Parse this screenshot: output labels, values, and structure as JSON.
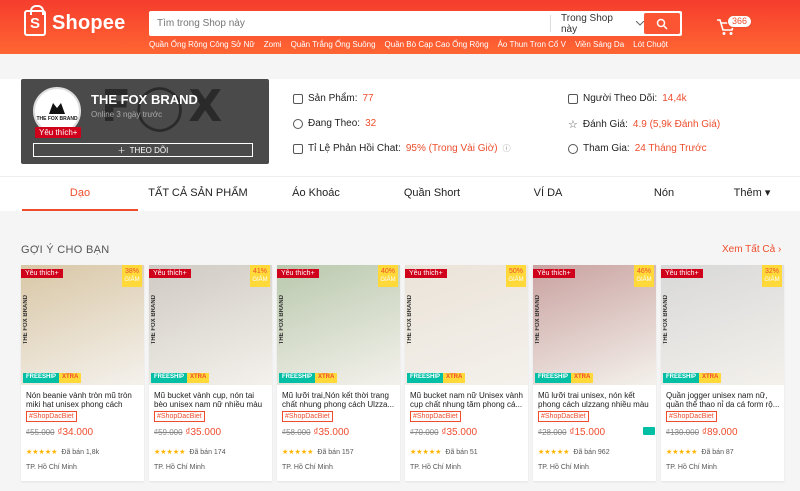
{
  "header": {
    "logo_text": "Shopee",
    "logo_glyph": "S",
    "search_placeholder": "Tìm trong Shop này",
    "search_scope": "Trong Shop này",
    "cart_count": "366",
    "keywords": [
      "Quần Ống Rộng Công Sở Nữ",
      "Zomi",
      "Quần Trắng Ống Suông",
      "Quần Bò Cạp Cao Ống Rộng",
      "Áo Thun Tron Cổ V",
      "Viền Sáng Da",
      "Lót Chuột"
    ]
  },
  "shop": {
    "name": "THE FOX BRAND",
    "online": "Online 3 ngày trước",
    "badge": "Yêu thích+",
    "follow_label": "THEO DÕI",
    "avatar_text": "THE FOX BRAND",
    "bg_text": "F◯X",
    "stats": {
      "products_label": "Sản Phẩm:",
      "products_value": "77",
      "following_label": "Đang Theo:",
      "following_value": "32",
      "chat_label": "Tỉ Lệ Phản Hồi Chat:",
      "chat_value": "95% (Trong Vài Giờ)",
      "followers_label": "Người Theo Dõi:",
      "followers_value": "14,4k",
      "rating_label": "Đánh Giá:",
      "rating_value": "4.9 (5,9k Đánh Giá)",
      "joined_label": "Tham Gia:",
      "joined_value": "24 Tháng Trước"
    }
  },
  "tabs": [
    "Dạo",
    "TẤT CẢ SẢN PHẨM",
    "Áo Khoác",
    "Quần Short",
    "VÍ DA",
    "Nón",
    "Thêm ▾"
  ],
  "recommend": {
    "title": "GỢI Ý CHO BẠN",
    "see_all": "Xem Tất Cả ›"
  },
  "products": [
    {
      "name": "Nón beanie vành tròn mũ tròn miki hạt unisex phong cách ret...",
      "discount": "38%",
      "old": "₫55.000",
      "new": "₫34.000",
      "sold": "Đã bán 1,8k",
      "loc": "TP. Hồ Chí Minh",
      "tag": "#ShopDacBiet",
      "off": "GIẢM",
      "ribbon": "Yêu thích+",
      "freeship_a": "FREESHIP",
      "freeship_b": "XTRA",
      "brand": "THE FOX BRAND",
      "color": "#d9c7a6",
      "stars": "★★★★★"
    },
    {
      "name": "Mũ bucket vành cụp, nón tai bèo unisex nam nữ nhiều màu pho...",
      "discount": "41%",
      "old": "₫59.000",
      "new": "₫35.000",
      "sold": "Đã bán 174",
      "loc": "TP. Hồ Chí Minh",
      "tag": "#ShopDacBiet",
      "off": "GIẢM",
      "ribbon": "Yêu thích+",
      "freeship_a": "FREESHIP",
      "freeship_b": "XTRA",
      "brand": "THE FOX BRAND",
      "color": "#cfcac3",
      "stars": "★★★★★"
    },
    {
      "name": "Mũ lưỡi trai,Nón kết thời trang chất nhung phong cách Ulzza...",
      "discount": "40%",
      "old": "₫58.000",
      "new": "₫35.000",
      "sold": "Đã bán 157",
      "loc": "TP. Hồ Chí Minh",
      "tag": "#ShopDacBiet",
      "off": "GIẢM",
      "ribbon": "Yêu thích+",
      "freeship_a": "FREESHIP",
      "freeship_b": "XTRA",
      "brand": "THE FOX BRAND",
      "color": "#b9c9ad",
      "stars": "★★★★★"
    },
    {
      "name": "Mũ bucket nam nữ Unisex vành cụp chất nhung tăm phong cá...",
      "discount": "50%",
      "old": "₫70.000",
      "new": "₫35.000",
      "sold": "Đã bán 51",
      "loc": "TP. Hồ Chí Minh",
      "tag": "#ShopDacBiet",
      "off": "GIẢM",
      "ribbon": "Yêu thích+",
      "freeship_a": "FREESHIP",
      "freeship_b": "XTRA",
      "brand": "THE FOX BRAND",
      "color": "#eae3d8",
      "stars": "★★★★★"
    },
    {
      "name": "Mũ lưỡi trai unisex, nón kết phong cách ulzzang nhiều màu ...",
      "discount": "46%",
      "old": "₫28.000",
      "new": "₫15.000",
      "sold": "Đã bán 962",
      "loc": "TP. Hồ Chí Minh",
      "tag": "#ShopDacBiet",
      "off": "GIẢM",
      "ribbon": "Yêu thích+",
      "freeship_a": "FREESHIP",
      "freeship_b": "XTRA",
      "brand": "THE FOX BRAND",
      "color": "#c9a2a0",
      "stars": "★★★★★"
    },
    {
      "name": "Quần jogger unisex nam nữ, quần thể thao nỉ da cá form rộ...",
      "discount": "32%",
      "old": "₫130.000",
      "new": "₫89.000",
      "sold": "Đã bán 87",
      "loc": "TP. Hồ Chí Minh",
      "tag": "#ShopDacBiet",
      "off": "GIẢM",
      "ribbon": "Yêu thích+",
      "freeship_a": "FREESHIP",
      "freeship_b": "XTRA",
      "brand": "THE FOX BRAND",
      "color": "#d8d8d8",
      "stars": "★★★★★"
    }
  ]
}
